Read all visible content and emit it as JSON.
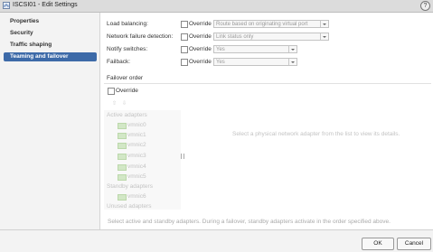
{
  "window": {
    "title": "ISCSI01 - Edit Settings",
    "help": "?"
  },
  "sidebar": {
    "items": [
      {
        "label": "Properties"
      },
      {
        "label": "Security"
      },
      {
        "label": "Traffic shaping"
      },
      {
        "label": "Teaming and failover"
      }
    ]
  },
  "settings": [
    {
      "label": "Load balancing:",
      "override": "Override",
      "value": "Route based on originating virtual port"
    },
    {
      "label": "Network failure detection:",
      "override": "Override",
      "value": "Link status only"
    },
    {
      "label": "Notify switches:",
      "override": "Override",
      "value": "Yes"
    },
    {
      "label": "Failback:",
      "override": "Override",
      "value": "Yes"
    }
  ],
  "failover": {
    "title": "Failover order",
    "override": "Override",
    "active_label": "Active adapters",
    "active": [
      "vmnic0",
      "vmnic1",
      "vmnic2",
      "vmnic3",
      "vmnic4",
      "vmnic5"
    ],
    "standby_label": "Standby adapters",
    "standby": [
      "vmnic6"
    ],
    "unused_label": "Unused adapters",
    "hint": "Select a physical network adapter from the list to view its details.",
    "note": "Select active and standby adapters. During a failover, standby adapters activate in the order specified above."
  },
  "buttons": {
    "ok": "OK",
    "cancel": "Cancel"
  },
  "colors": {
    "accent": "#3d6aa8",
    "nic": "#d2e7c6"
  }
}
